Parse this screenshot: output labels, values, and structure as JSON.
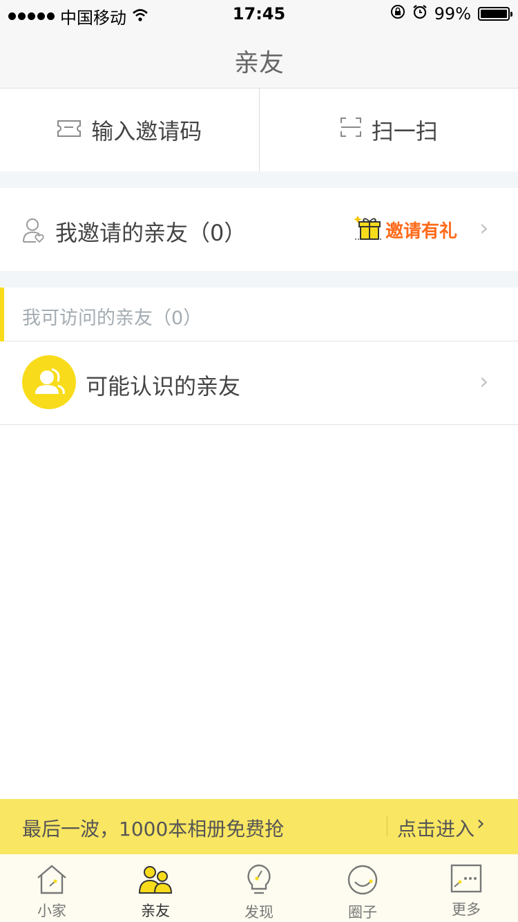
{
  "status_bar": {
    "carrier": "中国移动",
    "time": "17:45",
    "battery": "99%",
    "icons": [
      "signal-dots",
      "wifi-icon",
      "rotation-lock-icon",
      "alarm-icon",
      "battery-icon"
    ]
  },
  "header": {
    "title": "亲友"
  },
  "actions": {
    "invite_code": {
      "label": "输入邀请码",
      "icon": "ticket-icon"
    },
    "scan": {
      "label": "扫一扫",
      "icon": "scan-icon"
    }
  },
  "invited": {
    "label": "我邀请的亲友（0）",
    "icon": "user-heart-icon",
    "badge_text": "邀请有礼",
    "badge_icon": "gift-icon"
  },
  "accessible": {
    "label": "我可访问的亲友（0）"
  },
  "suggested": {
    "label": "可能认识的亲友",
    "icon": "people-icon"
  },
  "promo": {
    "text": "最后一波，1000本相册免费抢",
    "action": "点击进入"
  },
  "tabs": [
    {
      "label": "小家",
      "icon": "home-icon",
      "active": false
    },
    {
      "label": "亲友",
      "icon": "friends-icon",
      "active": true
    },
    {
      "label": "发现",
      "icon": "discover-icon",
      "active": false
    },
    {
      "label": "圈子",
      "icon": "circle-icon",
      "active": false
    },
    {
      "label": "更多",
      "icon": "more-icon",
      "active": false
    }
  ],
  "colors": {
    "accent": "#f8dc1b",
    "banner": "#f9e662",
    "badge_text": "#ff6a1a",
    "section_gap": "#f3f6f8"
  }
}
